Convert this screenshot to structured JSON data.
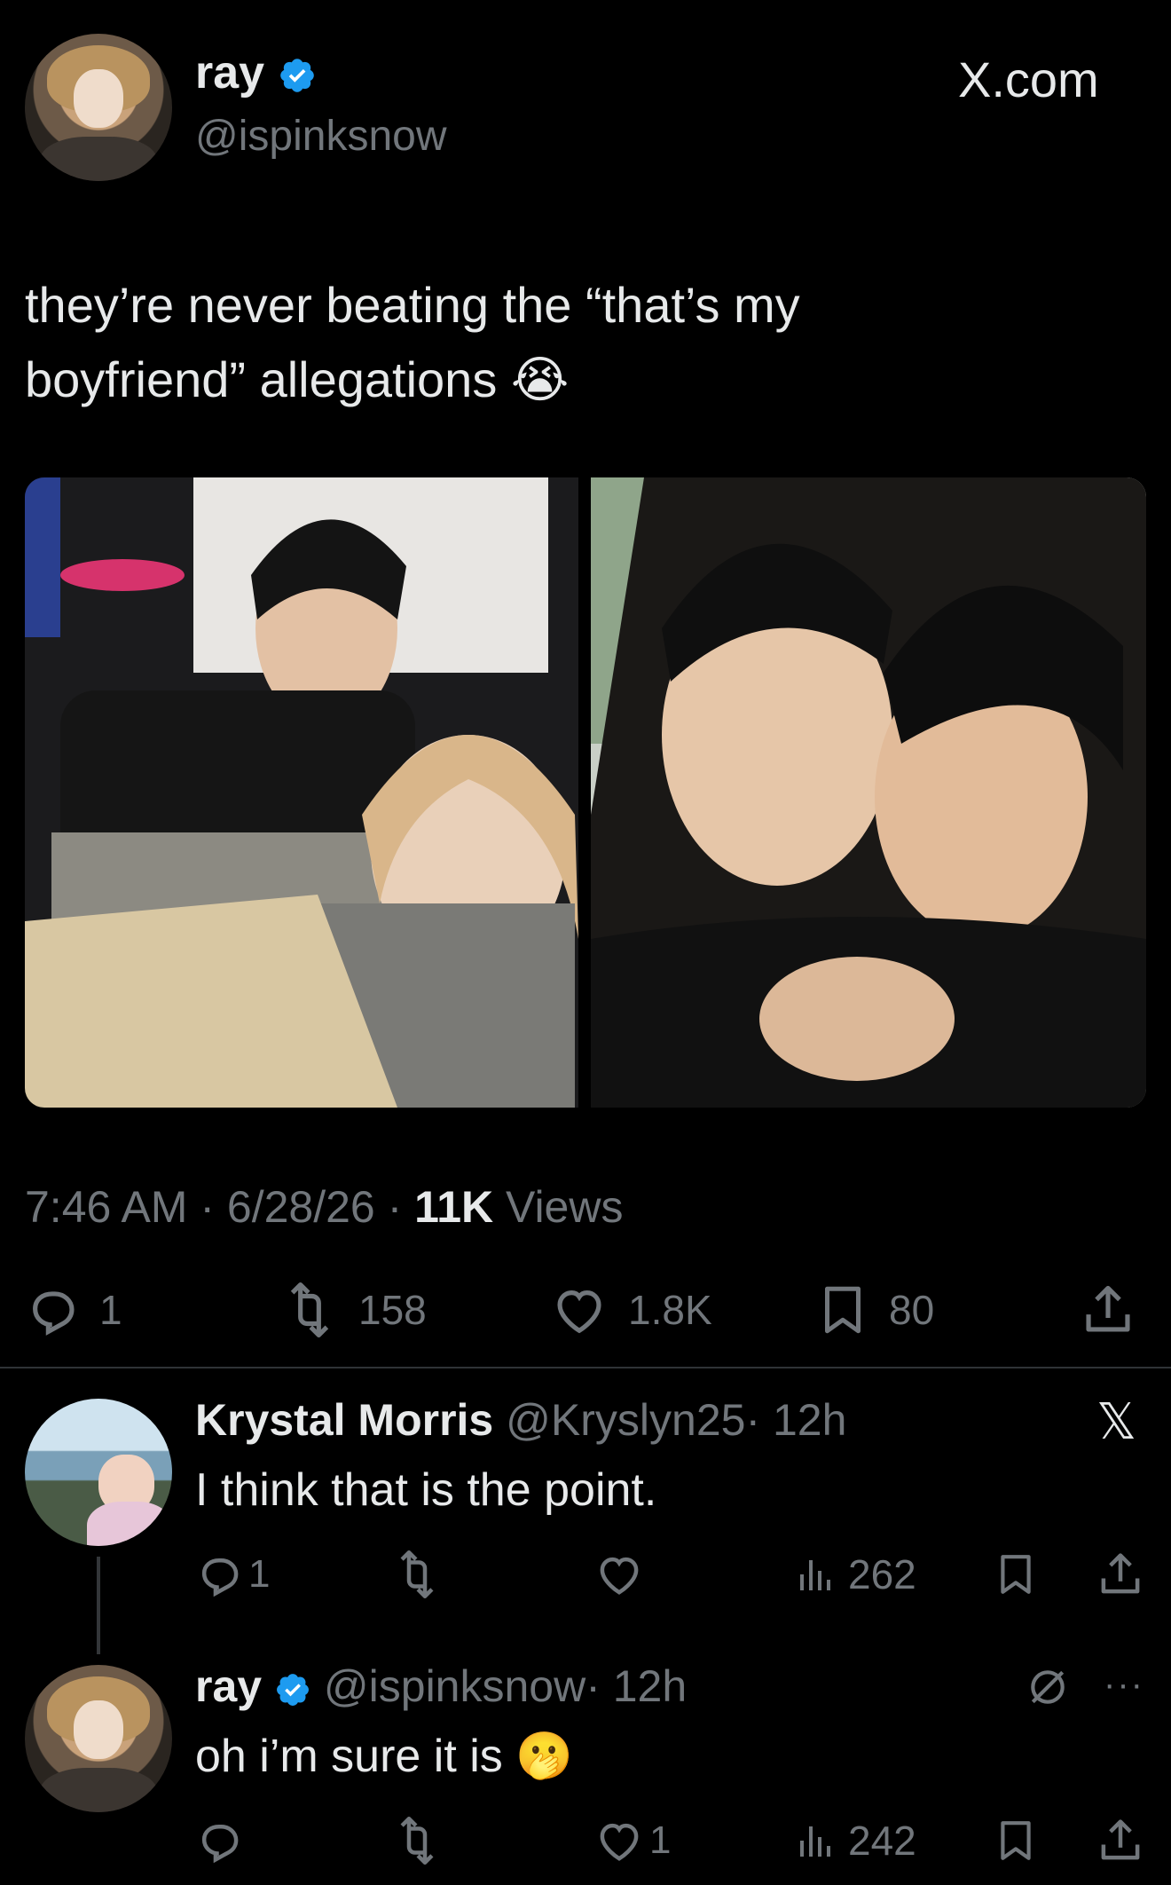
{
  "post": {
    "author_name": "ray",
    "author_handle": "@ispinksnow",
    "site_label": "X.com",
    "text_line1": "they’re never beating the “that’s my",
    "text_line2": "boyfriend” allegations",
    "emoji": "😭",
    "timestamp": "7:46 AM · 6/28/26 · ",
    "views_count": "11K",
    "views_label": " Views",
    "stats": {
      "replies": "1",
      "reposts": "158",
      "likes": "1.8K",
      "bookmarks": "80"
    }
  },
  "replies": [
    {
      "author_name": "Krystal Morris",
      "author_handle": "@Kryslyn25",
      "time": "· 12h",
      "text": "I think that is the point.",
      "replies": "1",
      "reposts": "",
      "likes": "",
      "views": "262"
    },
    {
      "author_name": "ray",
      "author_handle": "@ispinksnow",
      "time": "· 12h",
      "text": "oh i’m sure it is",
      "emoji": "🫢",
      "replies": "",
      "reposts": "",
      "likes": "1",
      "views": "242"
    }
  ],
  "icons": {
    "verified_color": "#1d9bf0",
    "icon_color": "#71767b"
  }
}
